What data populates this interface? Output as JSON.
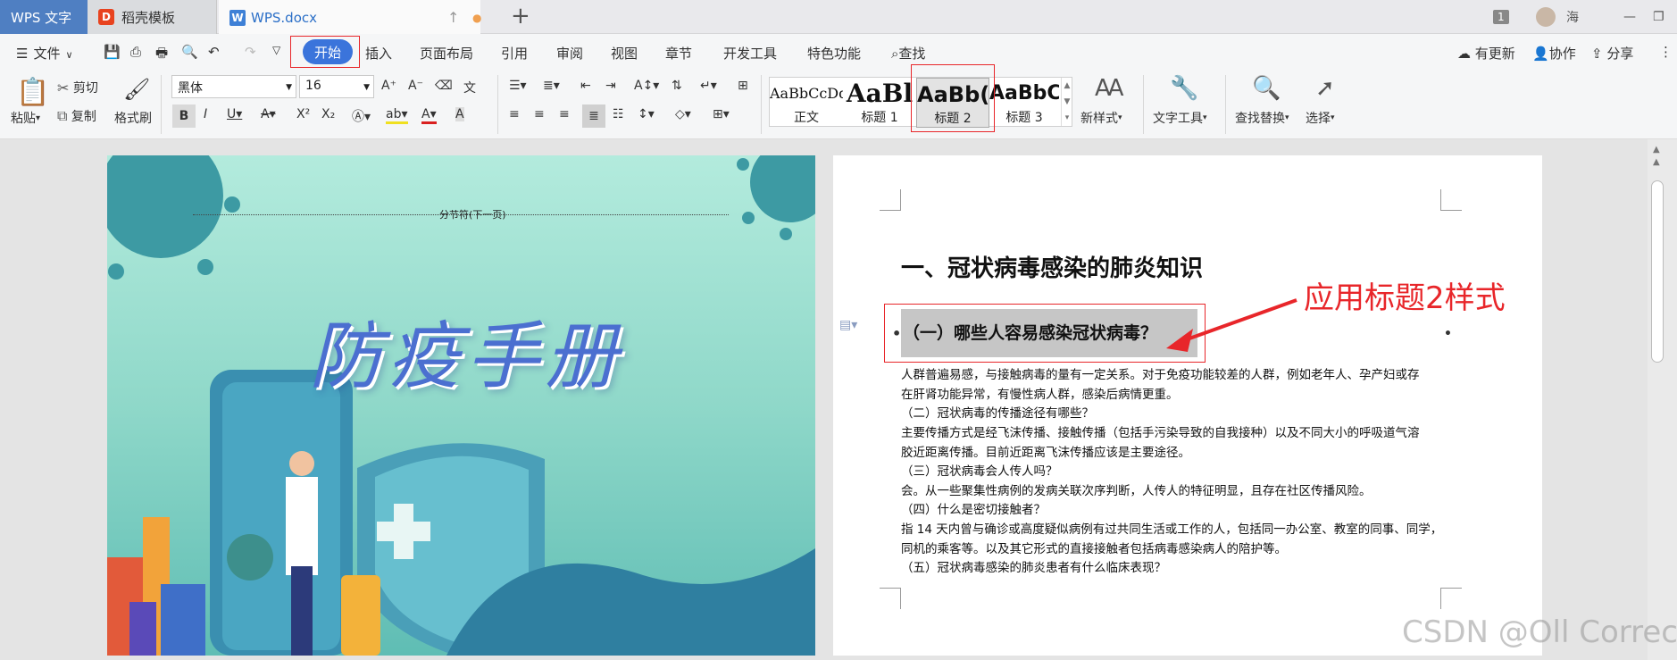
{
  "titlebar": {
    "app_tab": "WPS 文字",
    "docer_tab": "稻壳模板",
    "doc_tab": "WPS.docx",
    "doc_icon": "W",
    "docer_icon": "D",
    "window_count": "1",
    "user_name": "海"
  },
  "menu": {
    "file": "文件",
    "start": "开始",
    "insert": "插入",
    "layout": "页面布局",
    "references": "引用",
    "review": "审阅",
    "view": "视图",
    "chapter": "章节",
    "devtools": "开发工具",
    "features": "特色功能",
    "search": "查找",
    "update": "有更新",
    "collab": "协作",
    "share": "分享"
  },
  "ribbon": {
    "paste": "粘贴",
    "cut": "剪切",
    "copy": "复制",
    "format_painter": "格式刷",
    "font_name": "黑体",
    "font_size": "16",
    "styles": [
      {
        "sample": "AaBbCcDd",
        "label": "正文"
      },
      {
        "sample": "AaBl",
        "label": "标题 1"
      },
      {
        "sample": "AaBb(",
        "label": "标题 2"
      },
      {
        "sample": "AaBbC",
        "label": "标题 3"
      }
    ],
    "new_style": "新样式",
    "text_tools": "文字工具",
    "find_replace": "查找替换",
    "select": "选择"
  },
  "left_page": {
    "section_break": "分节符(下一页)",
    "cover_title": "防疫手册"
  },
  "right_page": {
    "heading1": "一、冠状病毒感染的肺炎知识",
    "heading2": "（一）哪些人容易感染冠状病毒？",
    "annotation": "应用标题2样式",
    "lines": [
      "人群普遍易感，与接触病毒的量有一定关系。对于免疫功能较差的人群，例如老年人、孕产妇或存",
      "在肝肾功能异常，有慢性病人群，感染后病情更重。",
      "（二）冠状病毒的传播途径有哪些？",
      "主要传播方式是经飞沫传播、接触传播（包括手污染导致的自我接种）以及不同大小的呼吸道气溶",
      "胶近距离传播。目前近距离飞沫传播应该是主要途径。",
      "（三）冠状病毒会人传人吗？",
      "会。从一些聚集性病例的发病关联次序判断，人传人的特征明显，且存在社区传播风险。",
      "（四）什么是密切接触者？",
      "指 14 天内曾与确诊或高度疑似病例有过共同生活或工作的人，包括同一办公室、教室的同事、同学，",
      "同机的乘客等。以及其它形式的直接接触者包括病毒感染病人的陪护等。",
      "（五）冠状病毒感染的肺炎患者有什么临床表现？"
    ]
  },
  "watermark": "CSDN @Oll Correct"
}
